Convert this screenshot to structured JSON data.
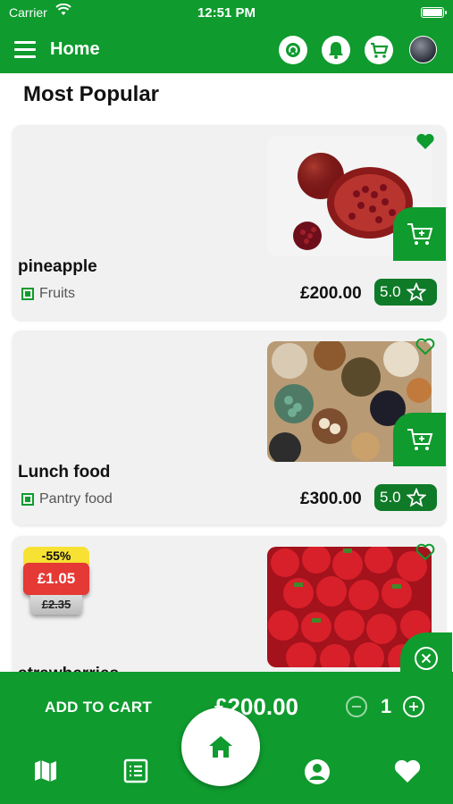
{
  "status_bar": {
    "carrier": "Carrier",
    "time": "12:51 PM"
  },
  "app_bar": {
    "title": "Home"
  },
  "section": {
    "title": "Most Popular"
  },
  "products": [
    {
      "name": "pineapple",
      "category": "Fruits",
      "price": "£200.00",
      "rating": "5.0",
      "favorite": true
    },
    {
      "name": "Lunch food",
      "category": "Pantry food",
      "price": "£300.00",
      "rating": "5.0",
      "favorite": false
    },
    {
      "name": "strawberries",
      "discount": {
        "percent": "-55%",
        "price": "£1.05",
        "old_price": "£2.35"
      },
      "favorite": false
    }
  ],
  "cart_bar": {
    "label": "ADD TO CART",
    "total": "£200.00",
    "quantity": "1"
  },
  "colors": {
    "primary": "#0f9b2e",
    "dark_primary": "#0f7a28",
    "discount_red": "#e53935",
    "discount_yellow": "#f7e234"
  },
  "icons": [
    "menu-icon",
    "refresh-icon",
    "bell-icon",
    "cart-icon",
    "avatar",
    "heart-icon",
    "add-to-cart-icon",
    "star-icon",
    "close-icon",
    "minus-icon",
    "plus-icon",
    "map-icon",
    "list-icon",
    "home-icon",
    "profile-icon"
  ]
}
